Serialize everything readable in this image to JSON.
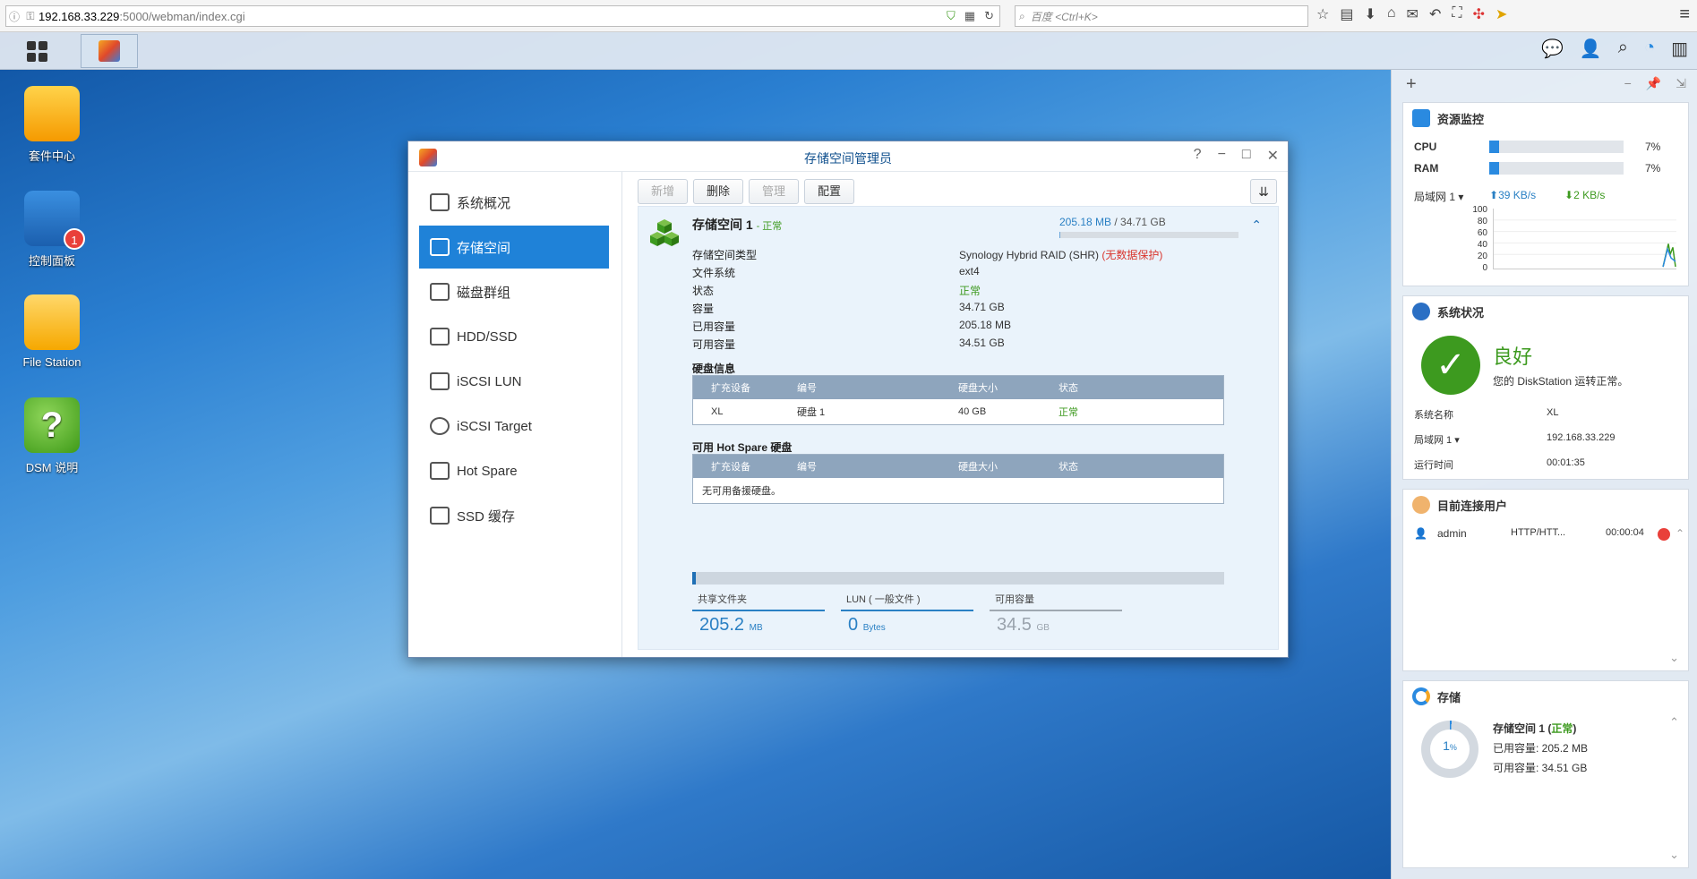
{
  "browser": {
    "url_host": "192.168.33.229",
    "url_path": ":5000/webman/index.cgi",
    "search_placeholder": "百度 <Ctrl+K>"
  },
  "desktop": {
    "icons": [
      {
        "label": "套件中心",
        "icon": "package-center-icon"
      },
      {
        "label": "控制面板",
        "icon": "control-panel-icon",
        "badge": "1"
      },
      {
        "label": "File Station",
        "icon": "file-station-icon"
      },
      {
        "label": "DSM 说明",
        "icon": "help-icon",
        "glyph": "?"
      }
    ]
  },
  "window": {
    "title": "存储空间管理员",
    "nav": [
      {
        "label": "系统概况"
      },
      {
        "label": "存储空间"
      },
      {
        "label": "磁盘群组"
      },
      {
        "label": "HDD/SSD"
      },
      {
        "label": "iSCSI LUN"
      },
      {
        "label": "iSCSI Target"
      },
      {
        "label": "Hot Spare"
      },
      {
        "label": "SSD 缓存"
      }
    ],
    "active_nav": "存储空间",
    "toolbar": {
      "create": "新增",
      "delete": "删除",
      "manage": "管理",
      "config": "配置"
    },
    "volume": {
      "title": "存储空间 1",
      "status": "- 正常",
      "used": "205.18 MB",
      "total": " / 34.71 GB",
      "used_fraction": 0.006,
      "props": [
        {
          "key": "存储空间类型",
          "value": "Synology Hybrid RAID (SHR)",
          "extra": "(无数据保护)"
        },
        {
          "key": "文件系统",
          "value": "ext4"
        },
        {
          "key": "状态",
          "value": "正常"
        },
        {
          "key": "容量",
          "value": "34.71 GB"
        },
        {
          "key": "已用容量",
          "value": "205.18 MB"
        },
        {
          "key": "可用容量",
          "value": "34.51 GB"
        }
      ],
      "disk_section": "硬盘信息",
      "disk_headers": [
        "扩充设备",
        "编号",
        "硬盘大小",
        "状态"
      ],
      "disk_rows": [
        [
          "XL",
          "硬盘 1",
          "40 GB",
          "正常"
        ]
      ],
      "spare_section": "可用 Hot Spare 硬盘",
      "spare_headers": [
        "扩充设备",
        "编号",
        "硬盘大小",
        "状态"
      ],
      "spare_empty": "无可用备援硬盘。",
      "summary": [
        {
          "label": "共享文件夹",
          "value": "205.2",
          "unit": "MB"
        },
        {
          "label": "LUN ( 一般文件 )",
          "value": "0",
          "unit": "Bytes"
        },
        {
          "label": "可用容量",
          "value": "34.5",
          "unit": "GB"
        }
      ]
    }
  },
  "widgets": {
    "resource": {
      "title": "资源监控",
      "cpu_label": "CPU",
      "cpu_pct": "7%",
      "cpu_value": 0.07,
      "ram_label": "RAM",
      "ram_pct": "7%",
      "ram_value": 0.07,
      "net_label": "局域网 1 ▾",
      "up": "39 KB/s",
      "down": "2 KB/s",
      "graph_ticks": [
        "100",
        "80",
        "60",
        "40",
        "20",
        "0"
      ]
    },
    "status": {
      "title": "系统状况",
      "state": "良好",
      "message": "您的 DiskStation 运转正常。",
      "rows": [
        {
          "k": "系统名称",
          "v": "XL"
        },
        {
          "k": "局域网 1 ▾",
          "v": "192.168.33.229"
        },
        {
          "k": "运行时间",
          "v": "00:01:35"
        }
      ]
    },
    "users": {
      "title": "目前连接用户",
      "user": "admin",
      "protocol": "HTTP/HTT...",
      "time": "00:00:04"
    },
    "storage": {
      "title": "存储",
      "pct": "1",
      "pct_unit": "%",
      "vol": "存储空间 1 (",
      "vol_status": "正常",
      "vol_close": ")",
      "used": "已用容量: 205.2 MB",
      "free": "可用容量: 34.51 GB"
    }
  }
}
